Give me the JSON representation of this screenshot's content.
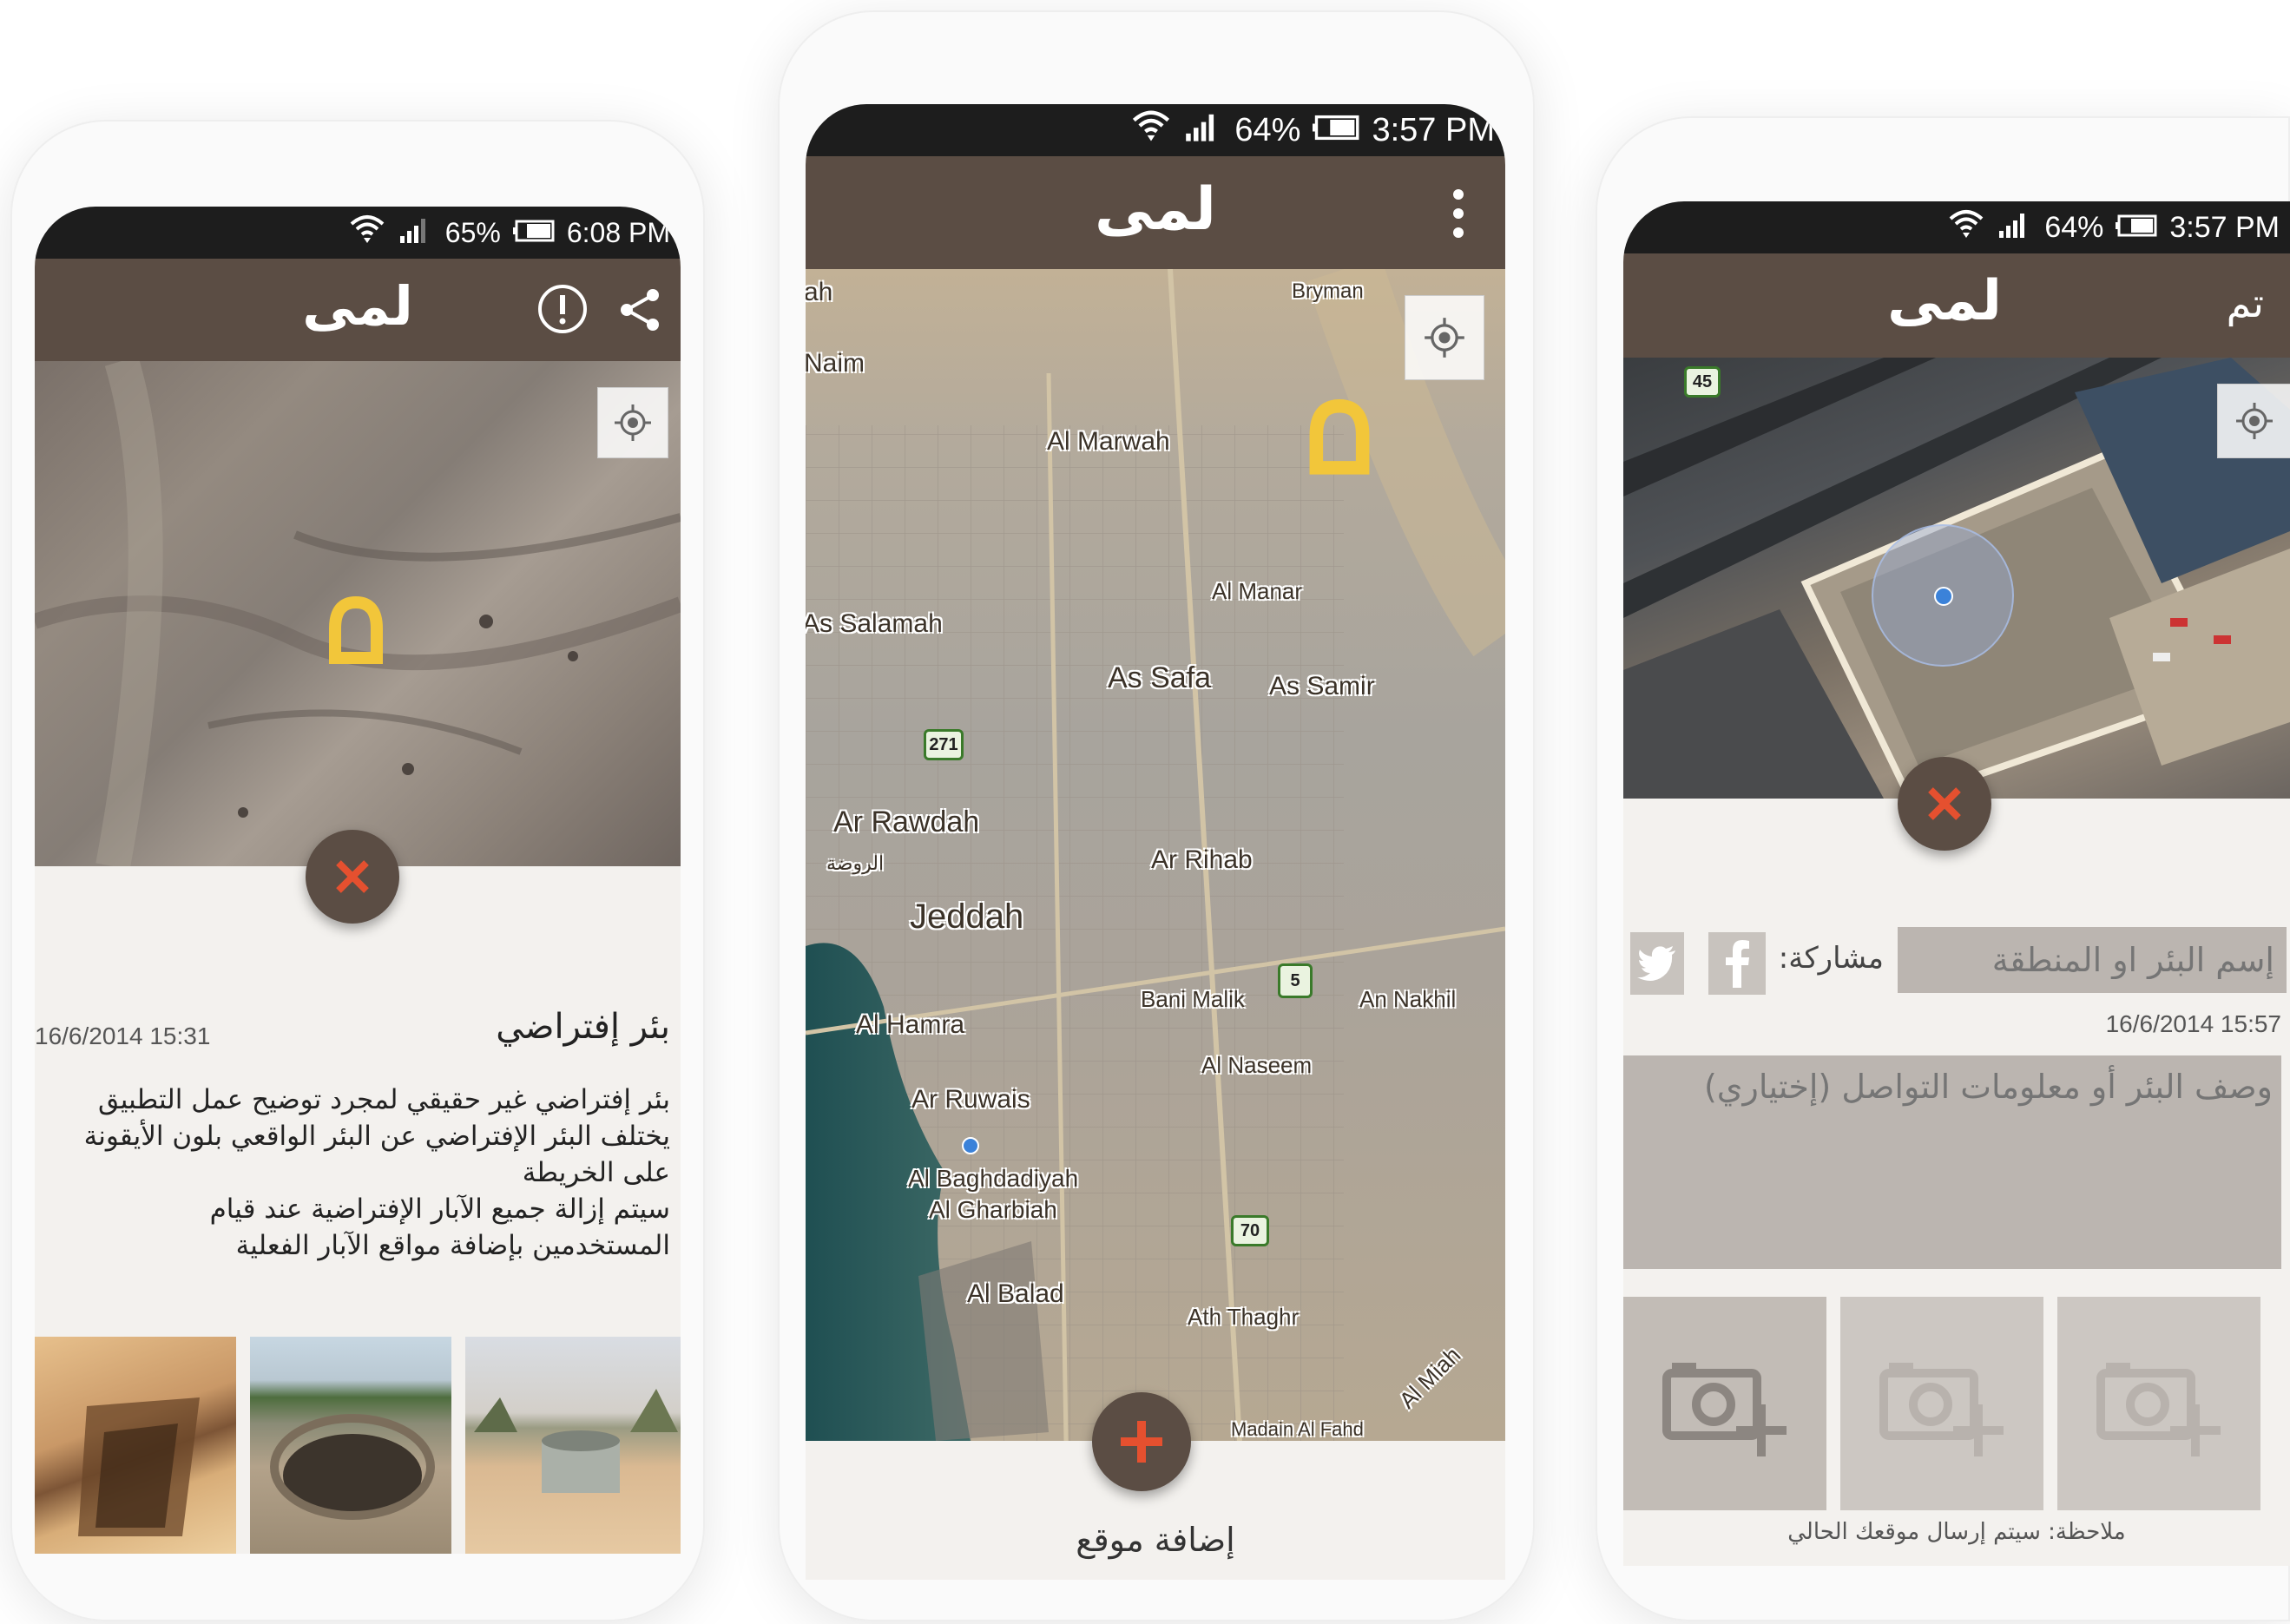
{
  "app": {
    "logo": "لمى"
  },
  "left": {
    "status": {
      "battery": "65%",
      "time": "6:08 PM"
    },
    "well": {
      "title": "بئر إفتراضي",
      "date": "16/6/2014  15:31",
      "description": [
        "بئر إفتراضي غير حقيقي لمجرد توضيح عمل التطبيق",
        "يختلف البئر الإفتراضي عن البئر الواقعي بلون الأيقونة",
        "على الخريطة",
        "سيتم إزالة جميع الآبار الإفتراضية عند قيام",
        "المستخدمين بإضافة مواقع الآبار الفعلية"
      ]
    },
    "icons": {
      "info": "info-icon",
      "share": "share-icon",
      "location": "my-location-icon",
      "close": "close-icon"
    }
  },
  "middle": {
    "status": {
      "battery": "64%",
      "time": "3:57 PM"
    },
    "map_labels": [
      "ah",
      "Bryman",
      "Naim",
      "Al Marwah",
      "Al Manar",
      "As Salamah",
      "As Safa",
      "As Samir",
      "Ar Rawdah",
      "الروضة",
      "Ar Rihab",
      "Jeddah",
      "Bani Malik",
      "An Nakhil",
      "Al Hamra",
      "Al Naseem",
      "Ar Ruwais",
      "Al Baghdadiyah",
      "Al Gharbiah",
      "Al Balad",
      "Ath Thaghr",
      "Al Miah",
      "Madain Al Fahd"
    ],
    "road_shields": [
      "271",
      "5",
      "70"
    ],
    "add_label": "إضافة موقع",
    "icons": {
      "menu": "overflow-menu-icon",
      "location": "my-location-icon",
      "add": "add-icon"
    }
  },
  "right": {
    "status": {
      "battery": "64%",
      "time": "3:57 PM"
    },
    "done_label": "تم",
    "map_shield": "45",
    "name_placeholder": "إسم البئر او المنطقة",
    "share_label": "مشاركة:",
    "date": "16/6/2014  15:57",
    "desc_placeholder": "وصف البئر أو معلومات التواصل (إختياري)",
    "note": "ملاحظة: سيتم إرسال موقعك الحالي",
    "icons": {
      "twitter": "twitter-icon",
      "facebook": "facebook-icon",
      "camera": "add-photo-icon",
      "close": "close-icon",
      "location": "my-location-icon"
    }
  },
  "colors": {
    "appbar": "#5b4d44",
    "accent_x": "#e5502f",
    "well_marker": "#f2c63a",
    "panel_bg": "#f3f1ee"
  }
}
